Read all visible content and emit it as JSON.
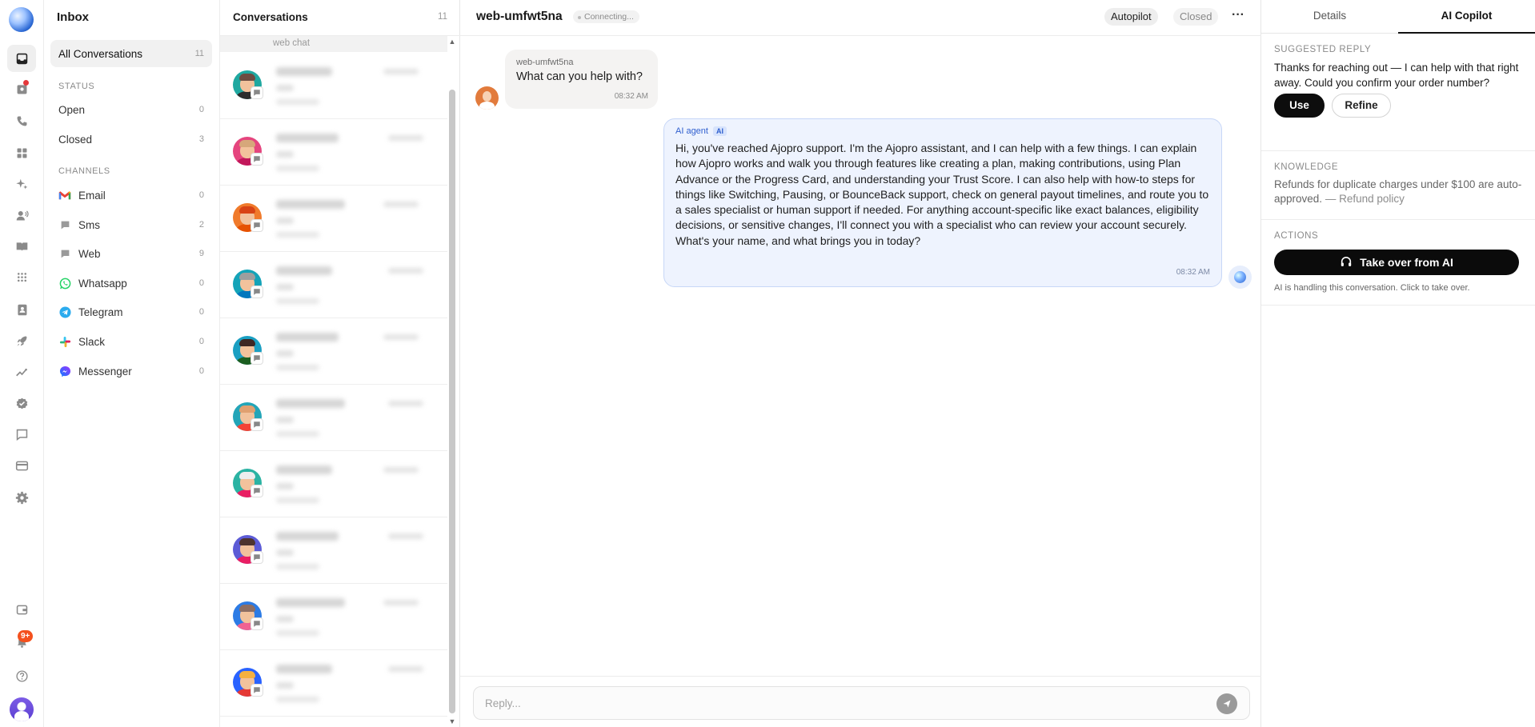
{
  "nav": {
    "title": "Inbox",
    "all": {
      "label": "All Conversations",
      "count": "11"
    },
    "status_title": "STATUS",
    "status": [
      {
        "label": "Open",
        "count": "0"
      },
      {
        "label": "Closed",
        "count": "3"
      }
    ],
    "channels_title": "CHANNELS",
    "channels": [
      {
        "label": "Email",
        "count": "0",
        "icon": "gmail-icon"
      },
      {
        "label": "Sms",
        "count": "2",
        "icon": "sms-icon"
      },
      {
        "label": "Web",
        "count": "9",
        "icon": "web-chat-icon"
      },
      {
        "label": "Whatsapp",
        "count": "0",
        "icon": "whatsapp-icon"
      },
      {
        "label": "Telegram",
        "count": "0",
        "icon": "telegram-icon"
      },
      {
        "label": "Slack",
        "count": "0",
        "icon": "slack-icon"
      },
      {
        "label": "Messenger",
        "count": "0",
        "icon": "messenger-icon"
      }
    ]
  },
  "rail": {
    "notifications_badge": "9+",
    "icons": [
      "inbox-icon",
      "contacts-alert-icon",
      "phone-icon",
      "apps-grid-icon",
      "sparkle-icon",
      "users-voice-icon",
      "book-icon",
      "dialpad-icon",
      "address-book-icon",
      "rocket-icon",
      "analytics-icon",
      "verified-icon",
      "chat-bubble-icon",
      "billing-card-icon",
      "settings-gear-icon",
      "wallet-icon",
      "bell-icon",
      "help-icon"
    ]
  },
  "list": {
    "title": "Conversations",
    "count": "11",
    "strip": "web chat"
  },
  "chat": {
    "title": "web-umfwt5na",
    "status": "Connecting...",
    "autopilot": "Autopilot",
    "closed": "Closed",
    "more": "···",
    "incoming": {
      "sender": "web-umfwt5na",
      "text": "What can you help with?",
      "time": "08:32 AM"
    },
    "ai": {
      "sender": "AI agent",
      "tag": "AI",
      "text": "Hi, you've reached Ajopro support. I'm the Ajopro assistant, and I can help with a few things. I can explain how Ajopro works and walk you through features like creating a plan, making contributions, using Plan Advance or the Progress Card, and understanding your Trust Score. I can also help with how-to steps for things like Switching, Pausing, or BounceBack support, check on general payout timelines, and route you to a sales specialist or human support if needed. For anything account-specific like exact balances, eligibility decisions, or sensitive changes, I'll connect you with a specialist who can review your account securely. What's your name, and what brings you in today?",
      "time": "08:32 AM"
    },
    "reply_placeholder": "Reply..."
  },
  "panel": {
    "tabs": [
      "Details",
      "AI Copilot"
    ],
    "suggested_title": "SUGGESTED REPLY",
    "suggested_text": "Thanks for reaching out — I can help with that right away. Could you confirm your order number?",
    "use": "Use",
    "refine": "Refine",
    "knowledge_title": "KNOWLEDGE",
    "knowledge_text": "Refunds for duplicate charges under $100 are auto-approved.",
    "knowledge_link": "— Refund policy",
    "actions_title": "ACTIONS",
    "takeover": "Take over from AI",
    "ai_note": "AI is handling this conversation. Click to take over."
  }
}
